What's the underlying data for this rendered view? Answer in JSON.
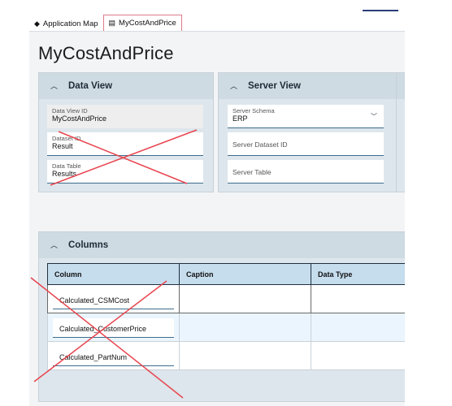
{
  "tabs": [
    {
      "label": "Application Map",
      "icon": "map-icon"
    },
    {
      "label": "MyCostAndPrice",
      "icon": "page-icon"
    }
  ],
  "page": {
    "title": "MyCostAndPrice"
  },
  "data_view": {
    "header": "Data View",
    "fields": {
      "data_view_id": {
        "label": "Data View ID",
        "value": "MyCostAndPrice"
      },
      "dataset_id": {
        "label": "Dataset ID",
        "value": "Result"
      },
      "data_table": {
        "label": "Data Table",
        "value": "Results"
      }
    }
  },
  "server_view": {
    "header": "Server View",
    "fields": {
      "server_schema": {
        "label": "Server Schema",
        "value": "ERP"
      },
      "server_dataset_id": {
        "placeholder": "Server Dataset ID"
      },
      "server_table": {
        "placeholder": "Server Table"
      }
    }
  },
  "columns": {
    "header": "Columns",
    "grid_headers": [
      "Column",
      "Caption",
      "Data Type"
    ],
    "rows": [
      "Calculated_CSMCost",
      "Calculated_CustomerPrice",
      "Calculated_PartNum"
    ]
  },
  "annotation_color": "#e8454f"
}
